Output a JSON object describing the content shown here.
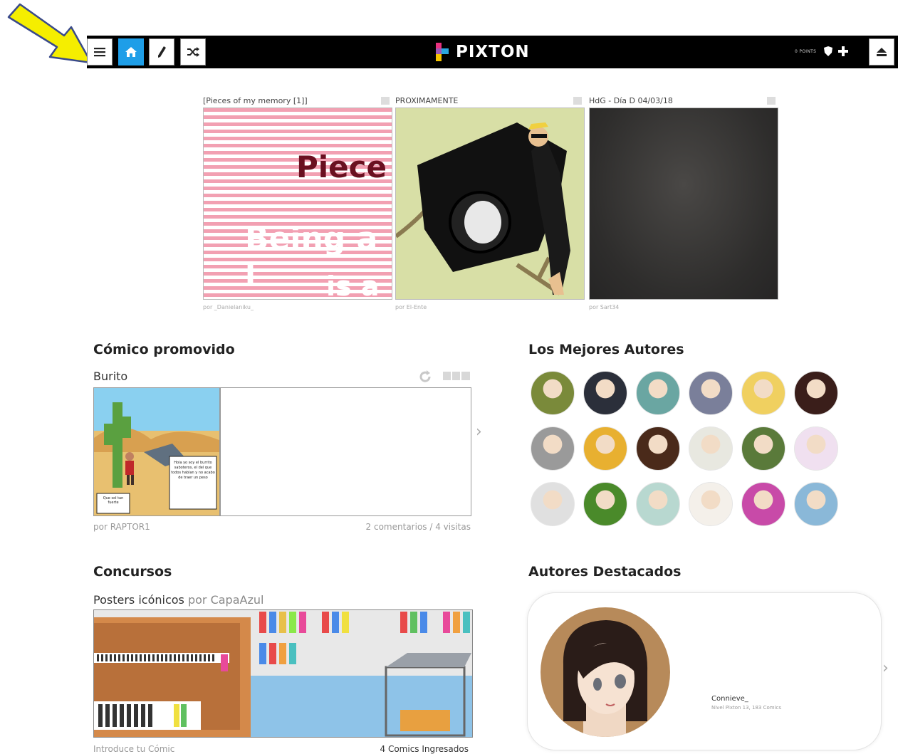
{
  "topbar": {
    "brand": "PIXTON",
    "points_label": "0 POINTS",
    "icons": [
      "menu-icon",
      "home-icon",
      "pencil-icon",
      "shuffle-icon",
      "shield-icon",
      "plus-icon",
      "eject-icon"
    ],
    "colors": {
      "bar": "#000000",
      "home_active": "#1e9ee8",
      "logo_pink": "#e8317f",
      "logo_blue": "#2aa7e0",
      "logo_yellow": "#f5c400"
    }
  },
  "featured": [
    {
      "title": "[Pieces of my memory [1]]",
      "author": "por _Danielaniku_",
      "art_text": [
        "Piece",
        "Being a l",
        "is a"
      ]
    },
    {
      "title": "PROXIMAMENTE",
      "author": "por El-Ente"
    },
    {
      "title": "HdG - Día D 04/03/18",
      "author": "por Sart34"
    }
  ],
  "promoted": {
    "heading": "Cómico promovido",
    "comic_title": "Burito",
    "bubble_small": "Que sol tan fuerte",
    "bubble_big": "Hola yo soy el burrito saboteros, el del que todos hablan y no acabo de traer un peso",
    "author": "por RAPTOR1",
    "stats": "2 comentarios / 4 visitas"
  },
  "top_authors": {
    "heading": "Los Mejores Autores",
    "avatars": [
      "#7a8a3a",
      "#2b2f3a",
      "#6aa6a2",
      "#7a7f9a",
      "#f0d060",
      "#3a1e1a",
      "#9a9a9a",
      "#e8b030",
      "#4a2a1a",
      "#e8e8e0",
      "#5a7a3a",
      "#f0e0f0",
      "#e0e0e0",
      "#4a8a2a",
      "#b8d8d0",
      "#f4f0ea",
      "#c84aa8",
      "#8ab8d8"
    ]
  },
  "contests": {
    "heading": "Concursos",
    "title": "Posters icónicos",
    "by_prefix": "por",
    "author": "CapaAzul",
    "enter_link": "Introduce tu Cómic",
    "entries": "4 Comics Ingresados"
  },
  "featured_authors": {
    "heading": "Autores Destacados",
    "name": "Connieve_",
    "meta": "Nivel Pixton 13, 183 Comics"
  }
}
